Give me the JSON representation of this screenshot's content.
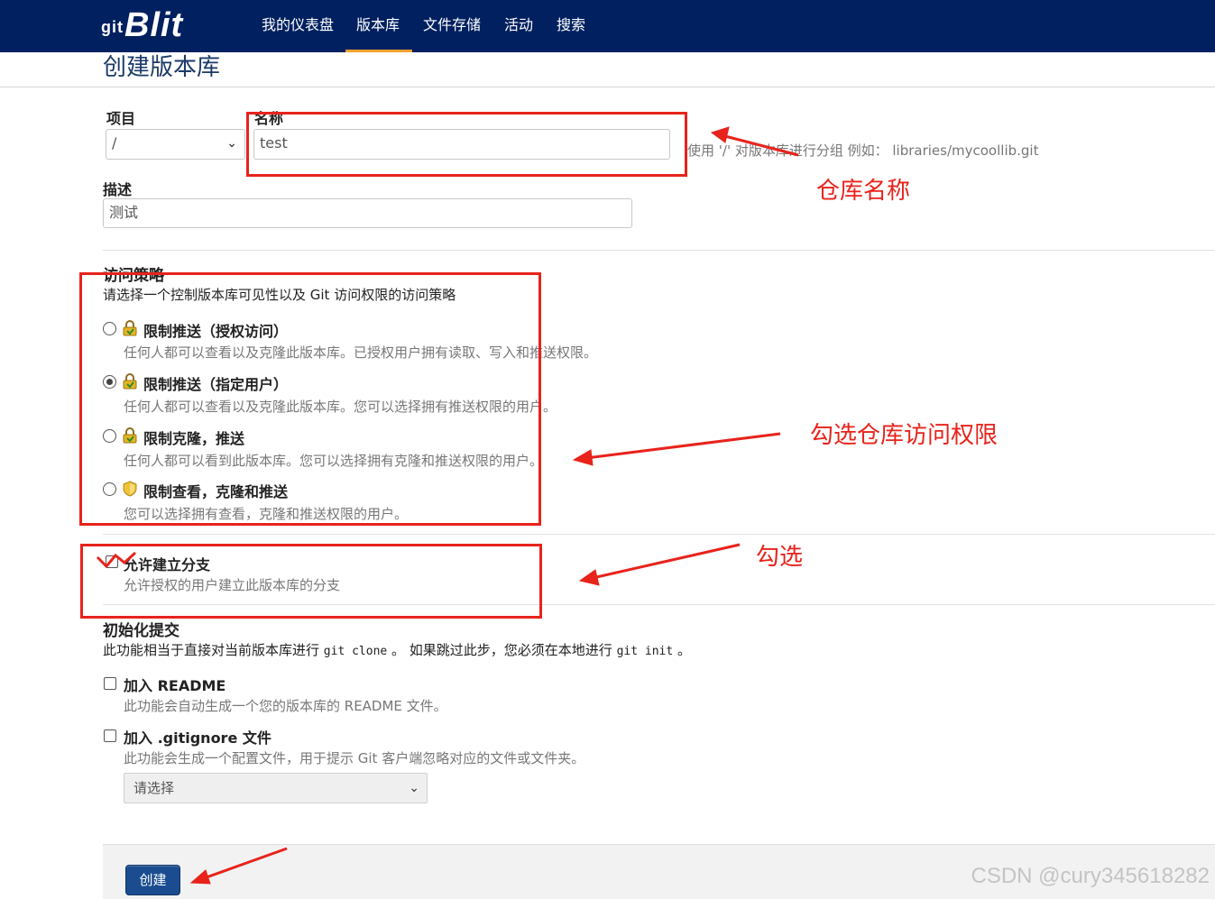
{
  "navbar": {
    "logo_prefix": "git",
    "logo": "Blit",
    "items": [
      {
        "label": "我的仪表盘"
      },
      {
        "label": "版本库"
      },
      {
        "label": "文件存储"
      },
      {
        "label": "活动"
      },
      {
        "label": "搜索"
      }
    ],
    "active_index": 1
  },
  "page": {
    "title": "创建版本库"
  },
  "form": {
    "project_label": "项目",
    "project_value": "/",
    "name_label": "名称",
    "name_value": "test",
    "name_help": "使用 '/' 对版本库进行分组 例如： libraries/mycoollib.git",
    "desc_label": "描述",
    "desc_value": "测试",
    "access": {
      "title": "访问策略",
      "subtitle": "请选择一个控制版本库可见性以及 Git 访问权限的访问策略",
      "options": [
        {
          "title": "限制推送（授权访问）",
          "desc": "任何人都可以查看以及克隆此版本库。已授权用户拥有读取、写入和推送权限。",
          "checked": false,
          "icon": "lock-green-icon"
        },
        {
          "title": "限制推送（指定用户）",
          "desc": "任何人都可以查看以及克隆此版本库。您可以选择拥有推送权限的用户。",
          "checked": true,
          "icon": "lock-green-icon"
        },
        {
          "title": "限制克隆，推送",
          "desc": "任何人都可以看到此版本库。您可以选择拥有克隆和推送权限的用户。",
          "checked": false,
          "icon": "lock-green-icon"
        },
        {
          "title": "限制查看，克隆和推送",
          "desc": "您可以选择拥有查看，克隆和推送权限的用户。",
          "checked": false,
          "icon": "shield-icon"
        }
      ]
    },
    "allow_fork": {
      "title": "允许建立分支",
      "desc": "允许授权的用户建立此版本库的分支",
      "checked": true
    },
    "init": {
      "title": "初始化提交",
      "desc_before": "此功能相当于直接对当前版本库进行",
      "cmd1": "git clone",
      "desc_mid": "。 如果跳过此步，您必须在本地进行",
      "cmd2": "git init",
      "desc_after": "。",
      "readme_title": "加入 README",
      "readme_desc": "此功能会自动生成一个您的版本库的 README 文件。",
      "gitignore_title": "加入 .gitignore 文件",
      "gitignore_desc": "此功能会生成一个配置文件，用于提示 Git 客户端忽略对应的文件或文件夹。",
      "gitignore_select": "请选择"
    },
    "create_button": "创建"
  },
  "annotations": {
    "repo_name": "仓库名称",
    "access_perm": "勾选仓库访问权限",
    "check": "勾选",
    "color": "#e8231b"
  },
  "watermark": "CSDN @cury345618282"
}
